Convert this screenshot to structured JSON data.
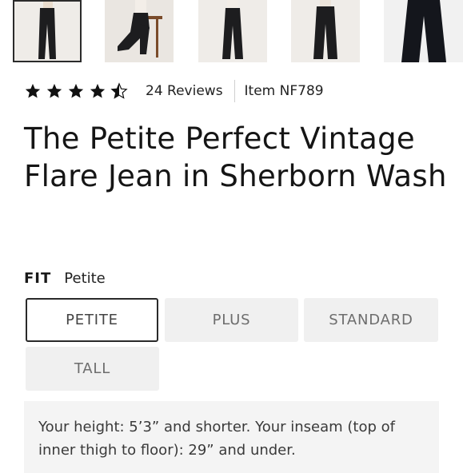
{
  "gallery": {
    "thumbnails": [
      {
        "alt": "model-front-view"
      },
      {
        "alt": "model-seated-view"
      },
      {
        "alt": "model-side-view"
      },
      {
        "alt": "model-back-view"
      },
      {
        "alt": "jean-flat-view"
      }
    ]
  },
  "rating": {
    "value": 4.5,
    "max": 5,
    "star_color": "#111111",
    "reviews_text": "24 Reviews",
    "item_text": "Item NF789"
  },
  "product": {
    "title": "The Petite Perfect Vintage Flare Jean in Sherborn Wash"
  },
  "fit": {
    "label": "FIT",
    "selected_value": "Petite",
    "options": [
      "PETITE",
      "PLUS",
      "STANDARD",
      "TALL"
    ],
    "description": "Your height: 5’3” and shorter. Your inseam (top of inner thigh to floor): 29” and under."
  }
}
